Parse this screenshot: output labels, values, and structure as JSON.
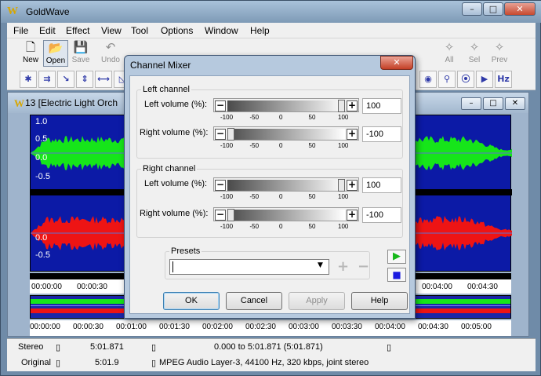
{
  "app": {
    "title": "GoldWave",
    "logo": "W"
  },
  "window_buttons": {
    "minimize": "–",
    "maximize": "□",
    "close": "✕"
  },
  "menu": [
    "File",
    "Edit",
    "Effect",
    "View",
    "Tool",
    "Options",
    "Window",
    "Help"
  ],
  "toolbar": [
    {
      "label": "New",
      "icon": "new-document-icon",
      "glyph": "🗋",
      "state": "normal"
    },
    {
      "label": "Open",
      "icon": "open-folder-icon",
      "glyph": "📂",
      "state": "normal"
    },
    {
      "label": "Save",
      "icon": "save-icon",
      "glyph": "💾",
      "state": "disabled"
    },
    {
      "label": "Undo",
      "icon": "undo-icon",
      "glyph": "↶",
      "state": "disabled"
    },
    {
      "label": "All",
      "icon": "select-all-icon",
      "glyph": "✧",
      "state": "disabled"
    },
    {
      "label": "Sel",
      "icon": "select-icon",
      "glyph": "✧",
      "state": "disabled"
    },
    {
      "label": "Prev",
      "icon": "previous-icon",
      "glyph": "✧",
      "state": "disabled"
    }
  ],
  "toolbar2_glyphs": [
    "✱",
    "⇉",
    "↘",
    "⇕",
    "⟷",
    "◺"
  ],
  "toolbar2_right_glyphs": [
    "◉",
    "⚲",
    "⦿",
    "▶",
    "Hz"
  ],
  "document": {
    "number": "13",
    "title": "13 [Electric Light Orch",
    "y_labels_top": [
      "1.0",
      "0.5",
      "0.0",
      "-0.5"
    ],
    "y_labels_bottom": [
      "0.0",
      "-0.5"
    ],
    "timeline_left": [
      "00:00:00",
      "00:00:30"
    ],
    "timeline_right": [
      "00:04:00",
      "00:04:30"
    ],
    "overview_ticks": [
      "00:00:00",
      "00:00:30",
      "00:01:00",
      "00:01:30",
      "00:02:00",
      "00:02:30",
      "00:03:00",
      "00:03:30",
      "00:04:00",
      "00:04:30",
      "00:05:00"
    ]
  },
  "colors": {
    "wave_bg": "#0c1aa6",
    "left_channel": "#16e51a",
    "right_channel": "#ee1414",
    "overview_bg": "#1a26a8"
  },
  "status": {
    "row1": {
      "mode": "Stereo",
      "length": "5:01.871",
      "selection": "0.000 to 5:01.871 (5:01.871)"
    },
    "row2": {
      "label": "Original",
      "length": "5:01.9",
      "format": "MPEG Audio Layer-3, 44100 Hz, 320 kbps, joint stereo"
    }
  },
  "dialog": {
    "title": "Channel Mixer",
    "close": "✕",
    "left_group": {
      "label": "Left channel",
      "left_volume_label": "Left volume (%):",
      "left_volume_value": "100",
      "left_volume_fraction": 1.0,
      "right_volume_label": "Right volume (%):",
      "right_volume_value": "-100",
      "right_volume_fraction": 0.0
    },
    "right_group": {
      "label": "Right channel",
      "left_volume_label": "Left volume (%):",
      "left_volume_value": "100",
      "left_volume_fraction": 1.0,
      "right_volume_label": "Right volume (%):",
      "right_volume_value": "-100",
      "right_volume_fraction": 0.0
    },
    "scale": [
      "-100",
      "-50",
      "0",
      "50",
      "100"
    ],
    "presets": {
      "label": "Presets",
      "value": "",
      "add": "+",
      "remove": "−"
    },
    "buttons": {
      "ok": "OK",
      "cancel": "Cancel",
      "apply": "Apply",
      "help": "Help"
    },
    "play_glyph": "▶",
    "stop_glyph": "■"
  }
}
